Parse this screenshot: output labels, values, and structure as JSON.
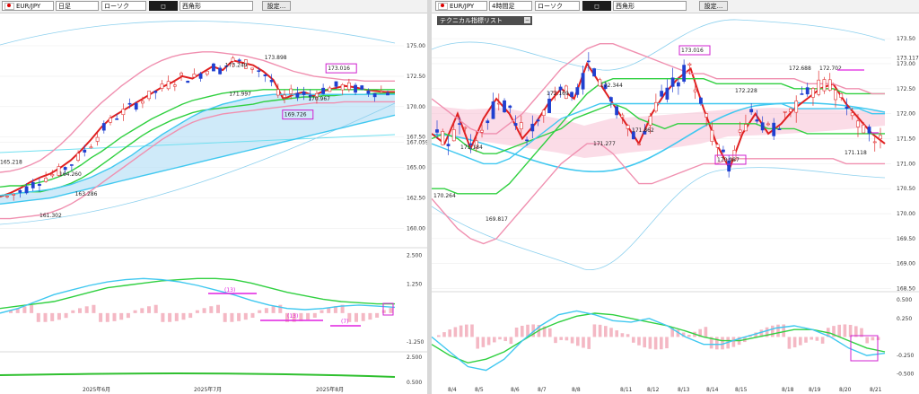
{
  "left_toolbar": {
    "symbol": "EUR/JPY",
    "timeframe": "日足",
    "chart_style": "ローソク",
    "drawing_tool": "西角形",
    "settings_label": "設定..."
  },
  "right_toolbar": {
    "symbol": "EUR/JPY",
    "timeframe": "4時間足",
    "chart_style": "ローソク",
    "drawing_tool": "西角形",
    "settings_label": "設定...",
    "indicator_list_label": "テクニカル指標リスト"
  },
  "chart_data": [
    {
      "id": "daily-main",
      "type": "candlestick",
      "title": "",
      "xlabel": "",
      "ylabel": "",
      "ylim": [
        159.0,
        176.4
      ],
      "y_ticks": [
        "175.00",
        "172.50",
        "170.00",
        "167.50",
        "167.059",
        "165.00",
        "162.50",
        "160.00"
      ],
      "x_ticks": [
        "2025年6月",
        "2025年7月",
        "2025年8月"
      ],
      "annotations": [
        {
          "text": "173.898",
          "x": 0.67,
          "y": 173.9
        },
        {
          "text": "173.249",
          "x": 0.57,
          "y": 173.25
        },
        {
          "text": "173.016",
          "x": 0.83,
          "y": 173.0,
          "boxed": true
        },
        {
          "text": "171.997",
          "x": 0.58,
          "y": 170.9
        },
        {
          "text": "170.967",
          "x": 0.78,
          "y": 170.5
        },
        {
          "text": "169.726",
          "x": 0.72,
          "y": 169.2,
          "boxed": true
        },
        {
          "text": "165.218",
          "x": 0.0,
          "y": 165.3
        },
        {
          "text": "164.260",
          "x": 0.15,
          "y": 164.3
        },
        {
          "text": "163.286",
          "x": 0.19,
          "y": 162.7
        },
        {
          "text": "161.302",
          "x": 0.1,
          "y": 160.9
        }
      ],
      "series": [
        {
          "name": "",
          "kind": "line",
          "color": "#e02020",
          "values": [
            162.6,
            162.9,
            163.3,
            163.8,
            164.2,
            164.5,
            165.0,
            165.6,
            166.4,
            167.3,
            168.3,
            169.1,
            169.6,
            170.1,
            170.6,
            171.1,
            171.6,
            172.0,
            172.5,
            172.3,
            172.8,
            173.3,
            173.0,
            173.8,
            173.6,
            173.4,
            172.9,
            172.2,
            170.6,
            171.0,
            171.2,
            170.9,
            171.3,
            171.5,
            171.7,
            171.6,
            171.4,
            171.3,
            171.2,
            171.2
          ]
        },
        {
          "name": "",
          "kind": "line",
          "color": "#30d040",
          "values": [
            163.4,
            163.5,
            163.5,
            163.6,
            163.8,
            164.0,
            164.3,
            164.7,
            165.2,
            165.8,
            166.3,
            166.9,
            167.5,
            168.0,
            168.5,
            169.0,
            169.4,
            169.8,
            170.2,
            170.5,
            170.7,
            170.9,
            171.1,
            171.2,
            171.3,
            171.3,
            171.4,
            171.4,
            171.4,
            171.4,
            171.4,
            171.4,
            171.4,
            171.4,
            171.4,
            171.4,
            171.4,
            171.4,
            171.4,
            171.4
          ]
        },
        {
          "name": "",
          "kind": "line",
          "color": "#30d040",
          "values": [
            162.7,
            162.8,
            162.9,
            163.0,
            163.0,
            163.2,
            163.4,
            163.7,
            164.1,
            164.6,
            165.2,
            165.8,
            166.4,
            167.0,
            167.6,
            168.1,
            168.5,
            168.9,
            169.2,
            169.5,
            169.7,
            169.8,
            169.9,
            170.0,
            170.1,
            170.2,
            170.4,
            170.5,
            170.6,
            170.7,
            170.8,
            170.8,
            170.9,
            170.9,
            171.0,
            171.0,
            171.0,
            171.1,
            171.1,
            171.1
          ]
        },
        {
          "name": "",
          "kind": "line",
          "color": "#40c8f0",
          "values": [
            162.7,
            162.8,
            162.9,
            163.0,
            163.1,
            163.2,
            163.4,
            163.6,
            163.9,
            164.2,
            164.6,
            165.0,
            165.5,
            166.0,
            166.6,
            167.1,
            167.7,
            168.2,
            168.7,
            169.2,
            169.6,
            169.9,
            170.2,
            170.4,
            170.6,
            170.8,
            170.9,
            171.0,
            171.0,
            171.0,
            171.0,
            171.0,
            171.0,
            171.0,
            171.0,
            171.0,
            171.0,
            171.0,
            171.0,
            171.0
          ]
        },
        {
          "name": "",
          "kind": "line",
          "color": "#40c8f0",
          "values": [
            162.0,
            162.1,
            162.2,
            162.3,
            162.4,
            162.5,
            162.7,
            162.9,
            163.1,
            163.3,
            163.5,
            163.7,
            163.9,
            164.1,
            164.3,
            164.5,
            164.7,
            164.9,
            165.1,
            165.3,
            165.5,
            165.7,
            165.9,
            166.1,
            166.3,
            166.5,
            166.7,
            166.9,
            167.1,
            167.3,
            167.5,
            167.7,
            167.9,
            168.1,
            168.3,
            168.5,
            168.7,
            168.9,
            169.1,
            169.3
          ]
        },
        {
          "name": "",
          "kind": "line",
          "color": "#f090b0",
          "values": [
            164.6,
            164.7,
            164.9,
            165.2,
            165.6,
            166.2,
            166.9,
            167.7,
            168.6,
            169.5,
            170.3,
            171.0,
            171.7,
            172.3,
            172.9,
            173.4,
            173.8,
            174.1,
            174.3,
            174.4,
            174.5,
            174.5,
            174.4,
            174.3,
            174.2,
            174.0,
            173.8,
            173.5,
            173.2,
            172.9,
            172.7,
            172.5,
            172.4,
            172.3,
            172.2,
            172.2,
            172.1,
            172.1,
            172.1,
            172.1
          ]
        },
        {
          "name": "",
          "kind": "line",
          "color": "#f090b0",
          "values": [
            160.8,
            160.8,
            160.9,
            161.0,
            161.1,
            161.3,
            161.6,
            162.0,
            162.5,
            163.1,
            163.7,
            164.3,
            164.9,
            165.5,
            166.1,
            166.7,
            167.3,
            167.8,
            168.3,
            168.7,
            169.0,
            169.2,
            169.4,
            169.5,
            169.6,
            169.7,
            169.8,
            169.9,
            170.0,
            170.1,
            170.2,
            170.3,
            170.3,
            170.3,
            170.4,
            170.4,
            170.4,
            170.4,
            170.4,
            170.4
          ]
        }
      ]
    },
    {
      "id": "daily-macd",
      "type": "line",
      "title": "",
      "xlabel": "",
      "ylabel": "",
      "ylim": [
        -1.6,
        2.6
      ],
      "y_ticks": [
        "2.500",
        "1.250",
        "-1.250"
      ],
      "annotations": [
        {
          "text": "(13)"
        },
        {
          "text": "(13)"
        },
        {
          "text": "(7)"
        }
      ],
      "series": [
        {
          "name": "",
          "color": "#30d040",
          "values": [
            0.2,
            0.3,
            0.4,
            0.5,
            0.7,
            0.9,
            1.1,
            1.2,
            1.3,
            1.4,
            1.45,
            1.5,
            1.5,
            1.45,
            1.3,
            1.1,
            0.9,
            0.75,
            0.6,
            0.5,
            0.45,
            0.4,
            0.4
          ]
        },
        {
          "name": "",
          "color": "#40c8f0",
          "values": [
            0.0,
            0.2,
            0.5,
            0.8,
            1.0,
            1.2,
            1.35,
            1.45,
            1.5,
            1.45,
            1.35,
            1.2,
            1.0,
            0.8,
            0.55,
            0.35,
            0.2,
            0.15,
            0.2,
            0.3,
            0.35,
            0.3,
            0.25
          ]
        }
      ]
    },
    {
      "id": "4h-main",
      "type": "candlestick",
      "title": "",
      "xlabel": "",
      "ylabel": "",
      "ylim": [
        168.6,
        173.7
      ],
      "y_ticks": [
        "173.50",
        "173.117",
        "173.00",
        "172.50",
        "172.00",
        "171.50",
        "171.00",
        "170.50",
        "170.00",
        "169.50",
        "169.00",
        "168.50"
      ],
      "x_ticks": [
        "8/4",
        "8/5",
        "8/6",
        "8/7",
        "8/8",
        "8/11",
        "8/12",
        "8/13",
        "8/14",
        "8/15",
        "8/18",
        "8/19",
        "8/20",
        "8/21"
      ],
      "annotations": [
        {
          "text": "173.016",
          "boxed": true
        },
        {
          "text": "172.688"
        },
        {
          "text": "172.702"
        },
        {
          "text": "172.228"
        },
        {
          "text": "172.169"
        },
        {
          "text": "172.344"
        },
        {
          "text": "171.862"
        },
        {
          "text": "171.277"
        },
        {
          "text": "171.184"
        },
        {
          "text": "170.987",
          "boxed": true
        },
        {
          "text": "171.118"
        },
        {
          "text": "170.264"
        },
        {
          "text": "169.817"
        }
      ],
      "series": [
        {
          "name": "",
          "kind": "line",
          "color": "#e02020",
          "values": [
            171.6,
            171.4,
            172.0,
            171.3,
            171.9,
            172.3,
            172.0,
            171.5,
            171.8,
            172.2,
            172.5,
            172.3,
            173.0,
            172.6,
            172.2,
            171.8,
            171.4,
            172.0,
            172.4,
            172.7,
            172.9,
            172.1,
            171.4,
            170.9,
            171.6,
            172.0,
            171.6,
            171.8,
            172.1,
            172.3,
            172.5,
            172.6,
            172.2,
            171.9,
            171.6,
            171.4
          ]
        },
        {
          "name": "",
          "kind": "line",
          "color": "#30d040",
          "values": [
            170.5,
            170.5,
            170.4,
            170.4,
            170.4,
            170.4,
            170.6,
            170.9,
            171.2,
            171.5,
            171.8,
            172.1,
            172.4,
            172.6,
            172.7,
            172.7,
            172.7,
            172.7,
            172.7,
            172.7,
            172.7,
            172.7,
            172.6,
            172.6,
            172.6,
            172.6,
            172.6,
            172.6,
            172.5,
            172.5,
            172.5,
            172.5,
            172.4,
            172.4,
            172.4,
            172.4
          ]
        },
        {
          "name": "",
          "kind": "line",
          "color": "#30d040",
          "values": [
            171.5,
            171.6,
            171.5,
            171.3,
            171.2,
            171.2,
            171.3,
            171.4,
            171.5,
            171.6,
            171.7,
            171.9,
            172.0,
            172.1,
            172.2,
            172.1,
            171.9,
            171.8,
            171.7,
            171.8,
            171.8,
            171.8,
            171.8,
            171.8,
            171.8,
            171.8,
            171.7,
            171.7,
            171.7,
            171.6,
            171.6,
            171.6,
            171.6,
            171.6,
            171.6,
            171.6
          ]
        },
        {
          "name": "",
          "kind": "line",
          "color": "#40c8f0",
          "values": [
            171.4,
            171.3,
            171.2,
            171.1,
            171.0,
            171.0,
            171.1,
            171.3,
            171.5,
            171.7,
            171.9,
            172.0,
            172.1,
            172.2,
            172.2,
            172.2,
            172.2,
            172.2,
            172.2,
            172.2,
            172.2,
            172.2,
            172.2,
            172.2,
            172.2,
            172.2,
            172.2,
            172.2,
            172.1,
            172.1,
            172.1,
            172.1,
            172.1,
            172.1,
            172.0,
            172.0
          ]
        },
        {
          "name": "",
          "kind": "line",
          "color": "#f090b0",
          "values": [
            172.3,
            172.1,
            171.9,
            171.7,
            171.6,
            171.6,
            171.8,
            172.0,
            172.3,
            172.6,
            172.9,
            173.1,
            173.3,
            173.4,
            173.4,
            173.3,
            173.2,
            173.1,
            173.0,
            172.9,
            172.8,
            172.8,
            172.7,
            172.7,
            172.7,
            172.7,
            172.7,
            172.7,
            172.7,
            172.6,
            172.6,
            172.6,
            172.5,
            172.5,
            172.4,
            172.4
          ]
        },
        {
          "name": "",
          "kind": "line",
          "color": "#f090b0",
          "values": [
            170.3,
            170.0,
            169.7,
            169.5,
            169.4,
            169.5,
            169.8,
            170.1,
            170.4,
            170.7,
            171.0,
            171.2,
            171.4,
            171.4,
            171.2,
            170.9,
            170.6,
            170.6,
            170.7,
            170.8,
            170.9,
            171.0,
            171.0,
            171.1,
            171.1,
            171.1,
            171.1,
            171.1,
            171.1,
            171.1,
            171.1,
            171.1,
            171.0,
            171.0,
            171.0,
            171.0
          ]
        }
      ]
    },
    {
      "id": "4h-macd",
      "type": "line",
      "title": "",
      "xlabel": "",
      "ylabel": "",
      "ylim": [
        -0.6,
        0.55
      ],
      "y_ticks": [
        "0.500",
        "0.250",
        "-0.250",
        "-0.500"
      ],
      "series": [
        {
          "name": "",
          "color": "#30d040",
          "values": [
            -0.1,
            -0.25,
            -0.35,
            -0.3,
            -0.2,
            -0.05,
            0.1,
            0.2,
            0.28,
            0.32,
            0.3,
            0.25,
            0.2,
            0.15,
            0.08,
            0.0,
            -0.05,
            -0.05,
            0.0,
            0.05,
            0.1,
            0.1,
            0.05,
            -0.05,
            -0.15,
            -0.2
          ]
        },
        {
          "name": "",
          "color": "#40c8f0",
          "values": [
            0.0,
            -0.2,
            -0.4,
            -0.45,
            -0.3,
            -0.05,
            0.15,
            0.3,
            0.35,
            0.3,
            0.22,
            0.2,
            0.25,
            0.15,
            0.0,
            -0.1,
            -0.1,
            -0.02,
            0.05,
            0.12,
            0.15,
            0.1,
            0.0,
            -0.15,
            -0.25,
            -0.22
          ]
        }
      ]
    }
  ]
}
